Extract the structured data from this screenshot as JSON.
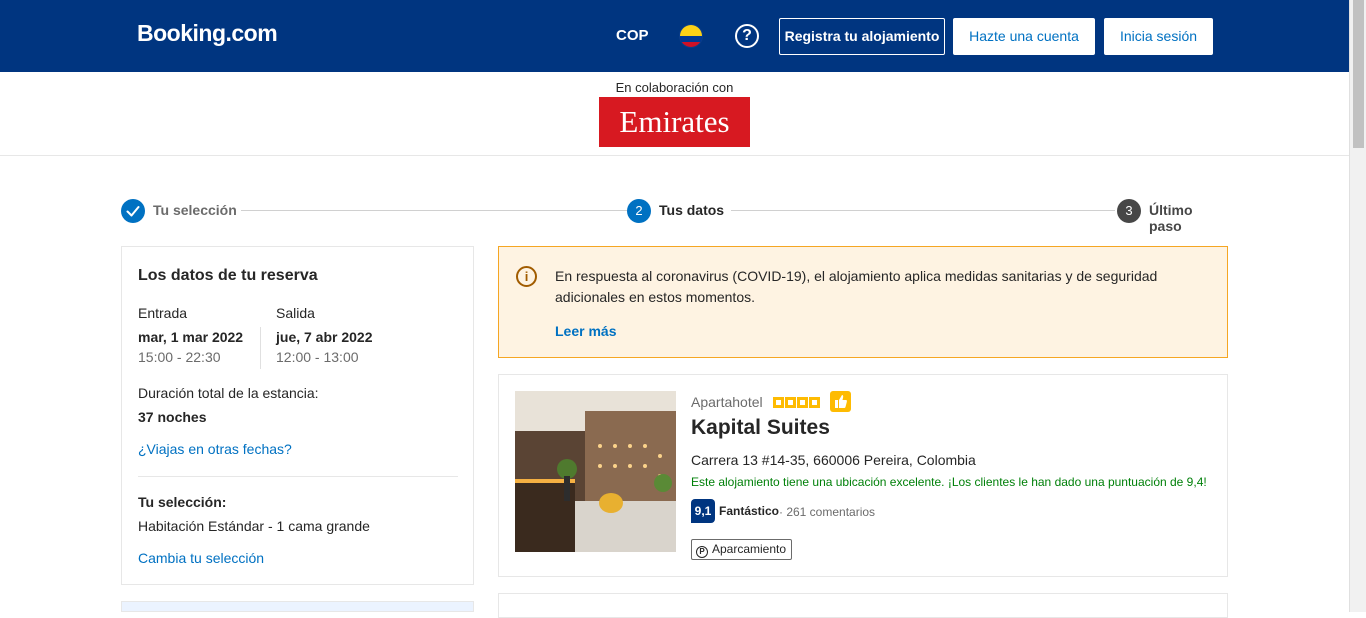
{
  "header": {
    "logo": "Booking.com",
    "currency": "COP",
    "help_icon": "question-circle-icon",
    "flag_icon": "colombia-flag-icon",
    "register_label": "Registra tu alojamiento",
    "create_account_label": "Hazte una cuenta",
    "login_label": "Inicia sesión",
    "colors": {
      "brand": "#003580",
      "link": "#0071c2"
    }
  },
  "partner": {
    "label": "En colaboración con",
    "logo_text": "Emirates",
    "logo_color": "#d71921"
  },
  "steps": [
    {
      "number": "✓",
      "label": "Tu selección",
      "state": "done"
    },
    {
      "number": "2",
      "label": "Tus datos",
      "state": "current"
    },
    {
      "number": "3",
      "label": "Último paso",
      "state": "pending"
    }
  ],
  "booking_summary": {
    "title": "Los datos de tu reserva",
    "checkin_label": "Entrada",
    "checkin_date": "mar, 1 mar 2022",
    "checkin_time": "15:00 - 22:30",
    "checkout_label": "Salida",
    "checkout_date": "jue, 7 abr 2022",
    "checkout_time": "12:00 - 13:00",
    "duration_label": "Duración total de la estancia:",
    "duration_value": "37 noches",
    "other_dates_link": "¿Viajas en otras fechas?",
    "selection_label": "Tu selección:",
    "selection_value": "Habitación Estándar - 1 cama grande",
    "change_selection_link": "Cambia tu selección"
  },
  "covid_notice": {
    "icon": "info-icon",
    "text": "En respuesta al coronavirus (COVID-19), el alojamiento aplica medidas sanitarias y de seguridad adicionales en estos momentos.",
    "link": "Leer más"
  },
  "hotel": {
    "type": "Apartahotel",
    "stars": 4,
    "name": "Kapital Suites",
    "address": "Carrera 13 #14-35, 660006 Pereira, Colombia",
    "location_note": "Este alojamiento tiene una ubicación excelente. ¡Los clientes le han dado una puntuación de 9,4!",
    "score": "9,1",
    "score_word": "Fantástico",
    "reviews": "· 261 comentarios",
    "facility": "Aparcamiento",
    "facility_icon": "parking-icon"
  }
}
